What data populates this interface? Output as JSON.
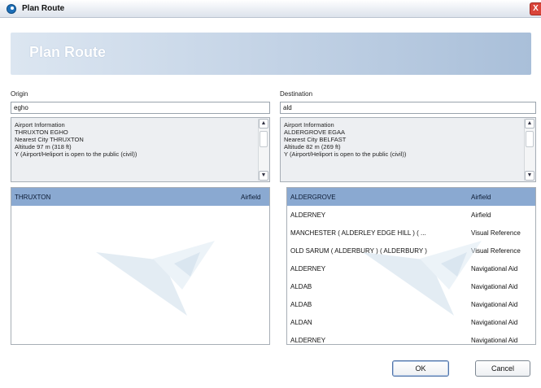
{
  "window": {
    "title": "Plan Route",
    "close_glyph": "X"
  },
  "banner": {
    "title": "Plan Route"
  },
  "origin": {
    "label": "Origin",
    "value": "egho",
    "info_lines": [
      "Airport Information",
      "THRUXTON EGHO",
      "Nearest City THRUXTON",
      "Altitude 97 m (318 ft)",
      "Y (Airport/Heliport is open to the public (civil))"
    ],
    "results": [
      {
        "name": "THRUXTON",
        "kind": "Airfield",
        "selected": true
      }
    ]
  },
  "destination": {
    "label": "Destination",
    "value": "ald",
    "info_lines": [
      "Airport Information",
      "ALDERGROVE EGAA",
      "Nearest City BELFAST",
      "Altitude 82 m (269 ft)",
      "Y (Airport/Heliport is open to the public (civil))"
    ],
    "results": [
      {
        "name": "ALDERGROVE",
        "kind": "Airfield",
        "selected": true
      },
      {
        "name": "ALDERNEY",
        "kind": "Airfield"
      },
      {
        "name": "MANCHESTER ( ALDERLEY EDGE HILL ) ( ...",
        "kind": "Visual Reference"
      },
      {
        "name": "OLD SARUM ( ALDERBURY ) ( ALDERBURY )",
        "kind": "Visual Reference"
      },
      {
        "name": "ALDERNEY",
        "kind": "Navigational Aid"
      },
      {
        "name": "ALDAB",
        "kind": "Navigational Aid"
      },
      {
        "name": "ALDAB",
        "kind": "Navigational Aid"
      },
      {
        "name": "ALDAN",
        "kind": "Navigational Aid"
      },
      {
        "name": "ALDERNEY",
        "kind": "Navigational Aid"
      }
    ]
  },
  "buttons": {
    "ok": "OK",
    "cancel": "Cancel"
  },
  "icons": {
    "app": "app-logo-icon",
    "close": "close-icon",
    "scroll_up": "scroll-up-arrow-icon",
    "scroll_down": "scroll-down-arrow-icon",
    "watermark": "bird-watermark-icon"
  },
  "colors": {
    "selection": "#8aa9d1",
    "banner_start": "#dce6f1",
    "banner_end": "#a9bfd9",
    "close": "#d9453a"
  }
}
